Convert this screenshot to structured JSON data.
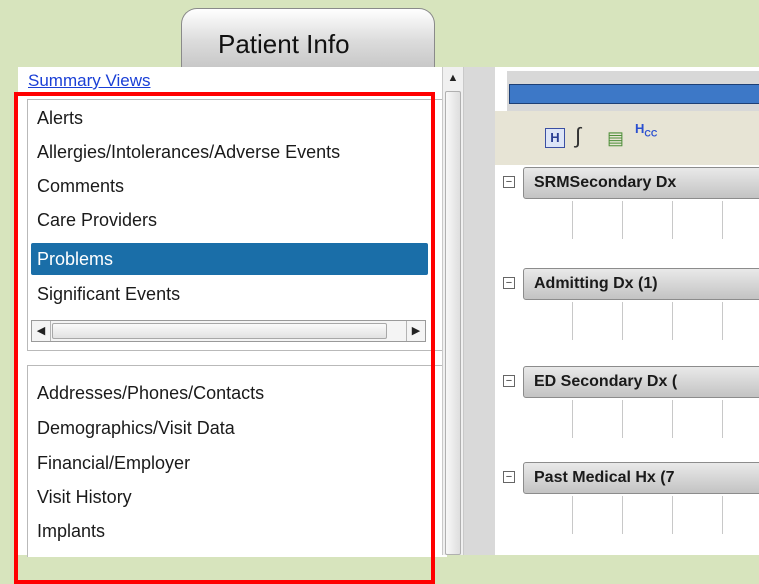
{
  "tab": {
    "label": "Patient Info"
  },
  "sidebar": {
    "summary_link": "Summary Views",
    "list1": [
      "Alerts",
      "Allergies/Intolerances/Adverse Events",
      "Comments",
      "Care Providers",
      "Problems",
      "Significant Events"
    ],
    "selected": "Problems",
    "list2": [
      "Addresses/Phones/Contacts",
      "Demographics/Visit Data",
      "Financial/Employer",
      "Visit History",
      "Implants"
    ]
  },
  "toolbar": {
    "icons": [
      "h-icon",
      "stethoscope-icon",
      "map-icon",
      "hcc-icon"
    ],
    "hcc_text": "HCC"
  },
  "sections": [
    {
      "title": "SRMSecondary Dx"
    },
    {
      "title": "Admitting Dx (1)"
    },
    {
      "title": "ED Secondary Dx ("
    },
    {
      "title": "Past Medical Hx (7"
    }
  ],
  "colors": {
    "accent": "#1a6ea8",
    "highlight_box": "#ff0000",
    "background": "#d7e4bd"
  }
}
